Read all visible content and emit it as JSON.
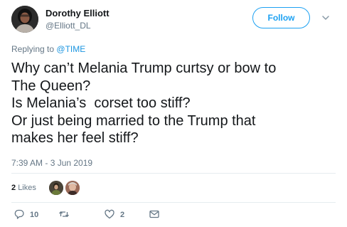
{
  "author": {
    "name": "Dorothy Elliott",
    "handle": "@Elliott_DL"
  },
  "follow_label": "Follow",
  "reply_context": {
    "prefix": "Replying to",
    "handle": "@TIME"
  },
  "tweet": {
    "lines": [
      "Why can’t Melania Trump curtsy or bow to",
      "The Queen?",
      "Is Melania’s  corset too stiff?",
      "Or just being married to the Trump that",
      "makes her feel stiff?"
    ],
    "timestamp": "7:39 AM - 3 Jun 2019"
  },
  "likes": {
    "count": "2",
    "label": "Likes"
  },
  "actions": {
    "reply_count": "10",
    "retweet_count": "",
    "like_count": "2"
  },
  "icons": {
    "caret": "chevron-down-icon",
    "reply": "reply-icon",
    "retweet": "retweet-icon",
    "like": "heart-icon",
    "dm": "envelope-icon"
  },
  "colors": {
    "accent": "#1da1f2",
    "secondary_text": "#657786",
    "primary_text": "#14171a"
  }
}
